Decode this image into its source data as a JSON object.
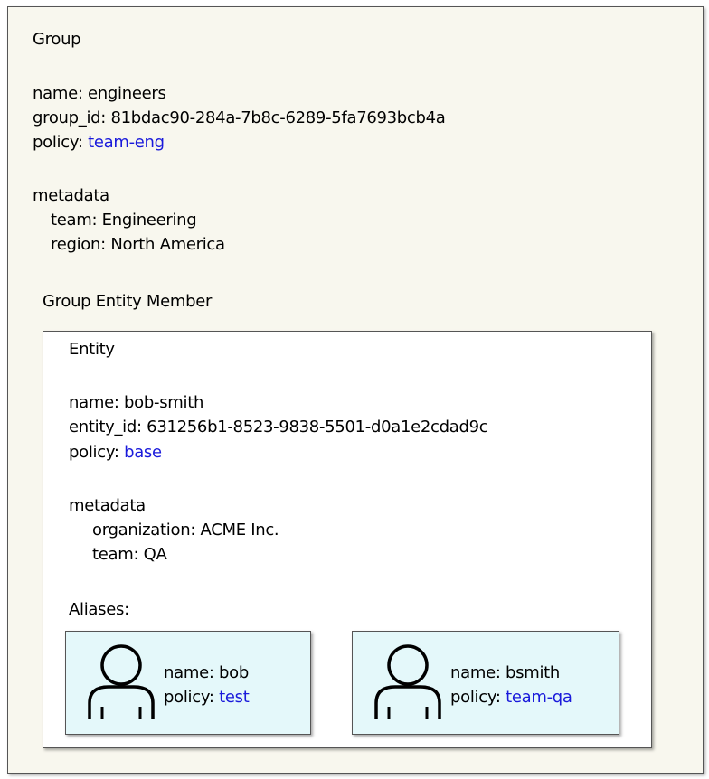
{
  "group": {
    "heading": "Group",
    "name_line": "name: engineers",
    "id_line": "group_id: 81bdac90-284a-7b8c-6289-5fa7693bcb4a",
    "policy_prefix": "policy: ",
    "policy_value": "team-eng",
    "metadata_heading": "metadata",
    "metadata": [
      "team: Engineering",
      "region: North America"
    ]
  },
  "member_heading": "Group Entity Member",
  "entity": {
    "heading": "Entity",
    "name_line": "name: bob-smith",
    "id_line": "entity_id: 631256b1-8523-9838-5501-d0a1e2cdad9c",
    "policy_prefix": "policy: ",
    "policy_value": "base",
    "metadata_heading": "metadata",
    "metadata": [
      "organization: ACME Inc.",
      "team: QA"
    ],
    "aliases_heading": "Aliases:"
  },
  "aliases": [
    {
      "icon": "person-icon",
      "name_line": "name: bob",
      "policy_prefix": "policy: ",
      "policy_value": "test"
    },
    {
      "icon": "person-icon",
      "name_line": "name: bsmith",
      "policy_prefix": "policy: ",
      "policy_value": "team-qa"
    }
  ],
  "colors": {
    "link": "#1a1adb",
    "group_fill": "#f8f7ee",
    "alias_fill": "#e4f8fa"
  }
}
